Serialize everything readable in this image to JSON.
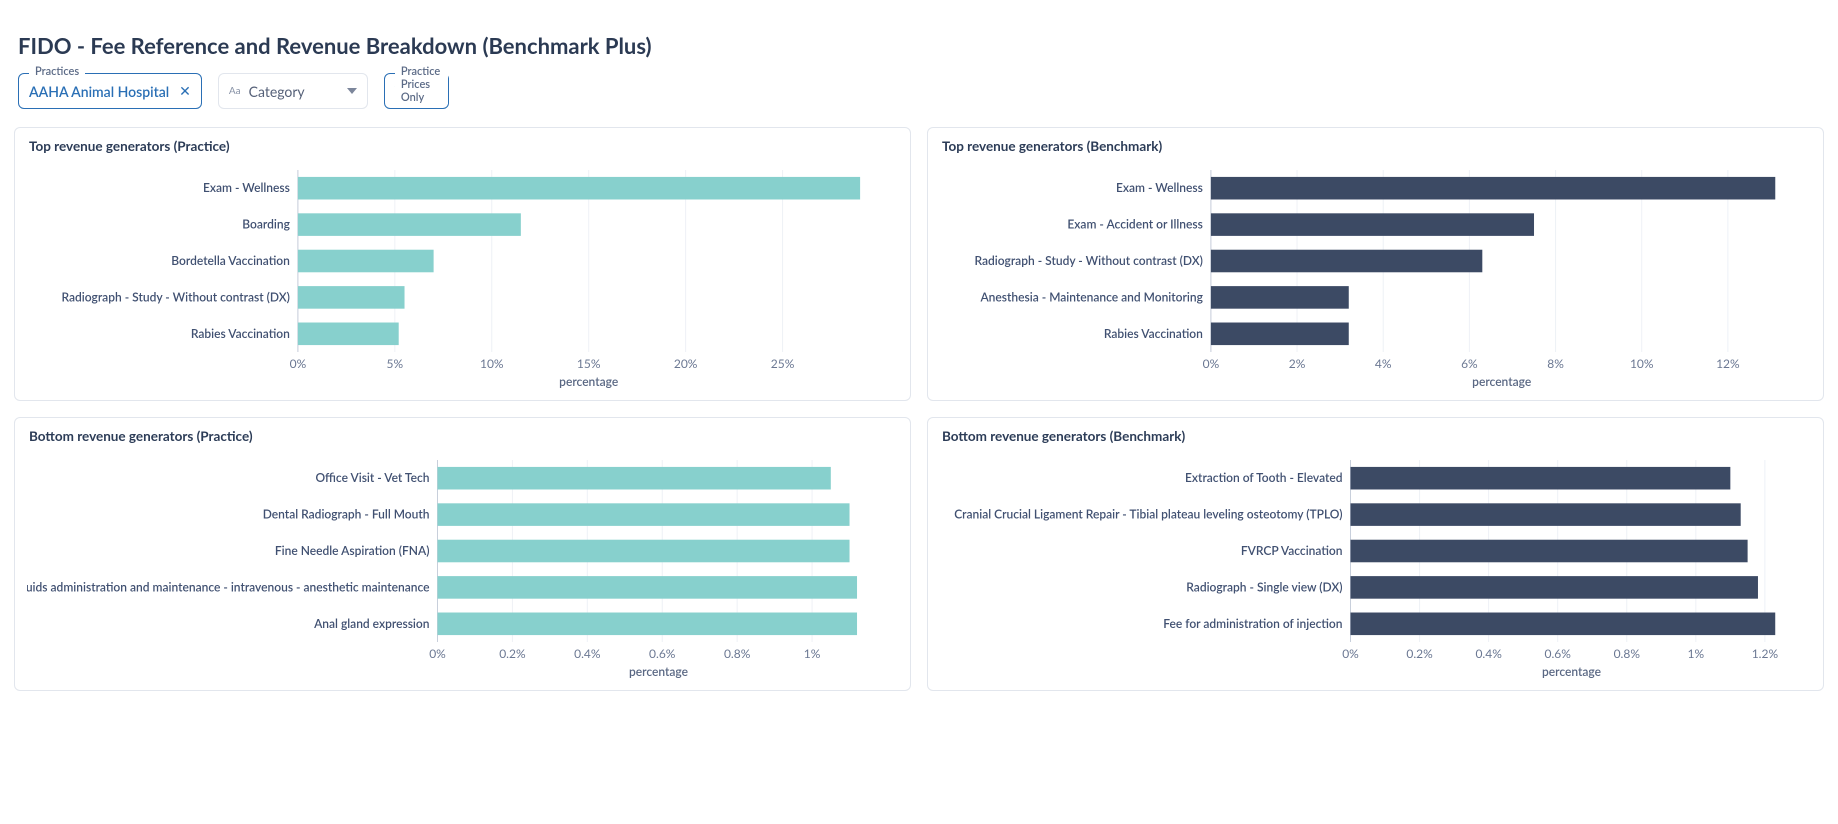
{
  "title": "FIDO - Fee Reference and Revenue Breakdown (Benchmark Plus)",
  "filters": {
    "practices_label": "Practices",
    "practices_value": "AAHA Animal Hospital",
    "category_label": "Category",
    "practice_prices_only_label": "Practice Prices Only",
    "practice_prices_only_value": "Yes"
  },
  "cards": {
    "top_practice": "Top revenue generators (Practice)",
    "top_benchmark": "Top revenue generators (Benchmark)",
    "bottom_practice": "Bottom revenue generators (Practice)",
    "bottom_benchmark": "Bottom revenue generators (Benchmark)"
  },
  "colors": {
    "teal": "#87d0cd",
    "navy": "#3c4a64"
  },
  "chart_data": [
    {
      "id": "top_practice",
      "type": "bar",
      "orientation": "horizontal",
      "color": "#87d0cd",
      "xlabel": "percentage",
      "xticks_format": "percent_whole",
      "xticks": [
        0,
        5,
        10,
        15,
        20,
        25
      ],
      "x_max": 30,
      "categories": [
        "Exam - Wellness",
        "Boarding",
        "Bordetella Vaccination",
        "Radiograph - Study - Without contrast (DX)",
        "Rabies Vaccination"
      ],
      "values": [
        29.0,
        11.5,
        7.0,
        5.5,
        5.2
      ]
    },
    {
      "id": "top_benchmark",
      "type": "bar",
      "orientation": "horizontal",
      "color": "#3c4a64",
      "xlabel": "percentage",
      "xticks_format": "percent_whole",
      "xticks": [
        0,
        2,
        4,
        6,
        8,
        10,
        12
      ],
      "x_max": 13.5,
      "categories": [
        "Exam - Wellness",
        "Exam - Accident or Illness",
        "Radiograph - Study - Without contrast (DX)",
        "Anesthesia - Maintenance and Monitoring",
        "Rabies Vaccination"
      ],
      "values": [
        13.1,
        7.5,
        6.3,
        3.2,
        3.2
      ]
    },
    {
      "id": "bottom_practice",
      "type": "bar",
      "orientation": "horizontal",
      "color": "#87d0cd",
      "xlabel": "percentage",
      "xticks_format": "percent_tenths",
      "xticks": [
        0,
        0.2,
        0.4,
        0.6,
        0.8,
        1.0
      ],
      "x_max": 1.18,
      "categories": [
        "Office Visit - Vet Tech",
        "Dental Radiograph - Full Mouth",
        "Fine Needle Aspiration (FNA)",
        "Fluids administration and maintenance - intravenous - anesthetic maintenance",
        "Anal gland expression"
      ],
      "values": [
        1.05,
        1.1,
        1.1,
        1.12,
        1.12
      ]
    },
    {
      "id": "bottom_benchmark",
      "type": "bar",
      "orientation": "horizontal",
      "color": "#3c4a64",
      "xlabel": "percentage",
      "xticks_format": "percent_tenths",
      "xticks": [
        0,
        0.2,
        0.4,
        0.6,
        0.8,
        1.0,
        1.2
      ],
      "x_max": 1.28,
      "categories": [
        "Extraction of Tooth - Elevated",
        "Cranial Crucial Ligament Repair - Tibial plateau leveling osteotomy (TPLO)",
        "FVRCP Vaccination",
        "Radiograph - Single view (DX)",
        "Fee for administration of injection"
      ],
      "values": [
        1.1,
        1.13,
        1.15,
        1.18,
        1.23
      ]
    }
  ]
}
